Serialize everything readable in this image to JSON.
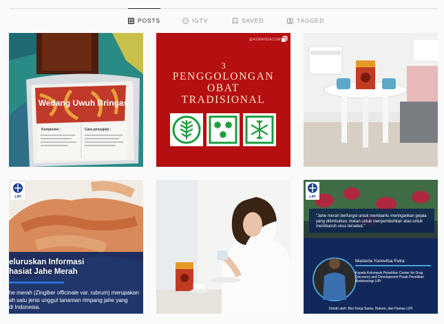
{
  "tabs": [
    {
      "label": "POSTS",
      "icon": "grid-icon",
      "active": true
    },
    {
      "label": "IGTV",
      "icon": "igtv-icon",
      "active": false
    },
    {
      "label": "SAVED",
      "icon": "bookmark-icon",
      "active": false
    },
    {
      "label": "TAGGED",
      "icon": "tagged-icon",
      "active": false
    }
  ],
  "posts": [
    {
      "product_name": "Wedang Uwuh Bringas",
      "label_left": "Komposisi :",
      "label_right": "Cara penyajian :"
    },
    {
      "handle": "@ASWANDACOM",
      "number": "3",
      "title_line1": "PENGGOLONGAN",
      "title_line2": "OBAT",
      "title_line3": "TRADISIONAL"
    },
    {
      "product_label": "Jahe Merah"
    },
    {
      "logo_text": "LIPI",
      "heading_line1": "eluruskan Informasi",
      "heading_line2": "hasiat Jahe Merah",
      "body_line1": "he merah (Zingiber officinale var. rubrum) merupakan",
      "body_line2": "ah satu jenis unggul tanaman rimpang jahe yang",
      "body_line3": "di Indonesia."
    },
    {
      "product_label": "Jahe Merah"
    },
    {
      "logo_text": "LIPI",
      "quote": "\"Jahe merah berfungsi untuk membantu meringankan gejala yang ditimbulkan, bukan untuk menyembuhkan atau untuk membunuh virus tersebut.\"",
      "person_name": "Masteria Yunovilsa Putra",
      "person_role": "Kepala Kelompok Penelitian Center for Drug Discovery and Development Pusat Penelitian Bioteknologi LIPI",
      "footer": "Diolah oleh: Biro Kerja Sama, Hukum, dan Humas LIPI"
    }
  ]
}
